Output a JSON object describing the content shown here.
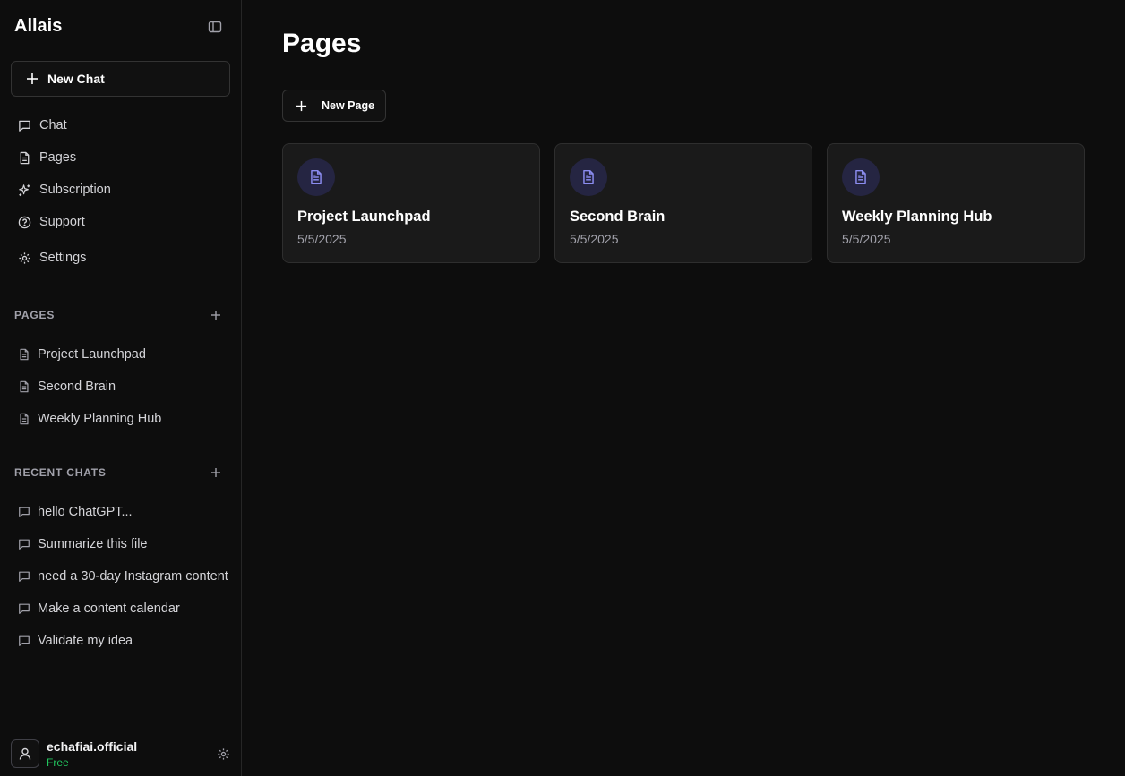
{
  "app": {
    "title": "Allais"
  },
  "sidebar": {
    "new_chat_label": "New Chat",
    "nav": [
      {
        "label": "Chat",
        "icon": "chat-icon"
      },
      {
        "label": "Pages",
        "icon": "document-icon"
      },
      {
        "label": "Subscription",
        "icon": "sparkles-icon"
      },
      {
        "label": "Support",
        "icon": "help-circle-icon"
      },
      {
        "label": "Settings",
        "icon": "gear-icon"
      }
    ],
    "pages_section": {
      "label": "PAGES",
      "items": [
        "Project Launchpad",
        "Second Brain",
        "Weekly Planning Hub"
      ]
    },
    "recent_section": {
      "label": "RECENT CHATS",
      "items": [
        "hello ChatGPT...",
        "Summarize this file",
        "need a 30-day Instagram content",
        "Make a content calendar",
        "Validate my idea"
      ]
    },
    "user": {
      "name": "echafiai.official",
      "plan": "Free"
    }
  },
  "main": {
    "title": "Pages",
    "new_page_label": "New Page",
    "cards": [
      {
        "title": "Project Launchpad",
        "date": "5/5/2025"
      },
      {
        "title": "Second Brain",
        "date": "5/5/2025"
      },
      {
        "title": "Weekly Planning Hub",
        "date": "5/5/2025"
      }
    ]
  },
  "colors": {
    "background": "#0d0d0d",
    "card": "#1a1a1a",
    "accent": "#8b8cf0",
    "plan": "#22c55e"
  }
}
